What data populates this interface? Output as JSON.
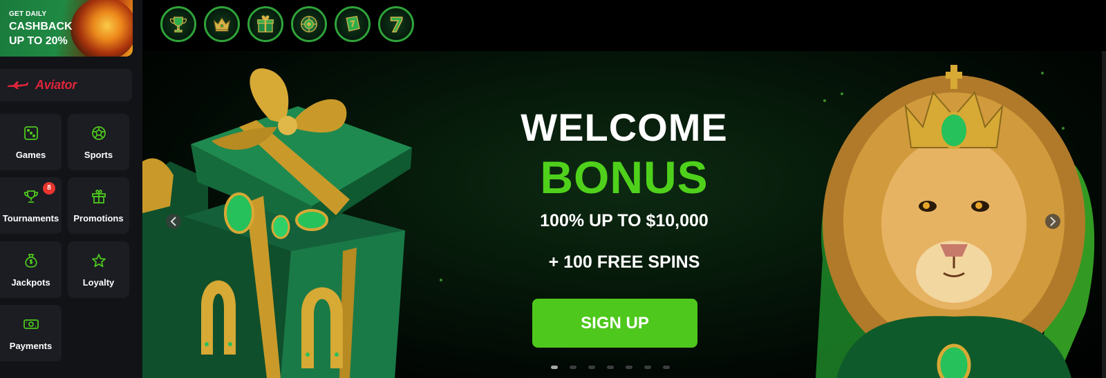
{
  "sidebar": {
    "promo": {
      "line1": "GET DAILY",
      "line2": "CASHBACK",
      "line3": "UP TO 20%"
    },
    "aviator_label": "Aviator",
    "tiles": [
      {
        "label": "Games",
        "icon": "dice-icon"
      },
      {
        "label": "Sports",
        "icon": "soccer-ball-icon"
      },
      {
        "label": "Tournaments",
        "icon": "trophy-icon",
        "badge": "8"
      },
      {
        "label": "Promotions",
        "icon": "gift-icon"
      },
      {
        "label": "Jackpots",
        "icon": "money-bag-icon"
      },
      {
        "label": "Loyalty",
        "icon": "star-icon"
      },
      {
        "label": "Payments",
        "icon": "cash-icon"
      }
    ]
  },
  "categories": [
    "trophy-icon",
    "crown-icon",
    "gift-box-icon",
    "roulette-icon",
    "slot-reel-icon",
    "lucky-seven-icon"
  ],
  "banner": {
    "title_line1": "WELCOME",
    "title_line2": "BONUS",
    "offer": "100% UP TO $10,000",
    "spins": "+ 100 FREE SPINS",
    "cta": "SIGN UP",
    "slide_count": 7,
    "active_slide": 1
  },
  "colors": {
    "accent": "#4ec81c",
    "badge": "#e8352e",
    "aviator": "#e0243a",
    "ring": "#2fa43a"
  }
}
